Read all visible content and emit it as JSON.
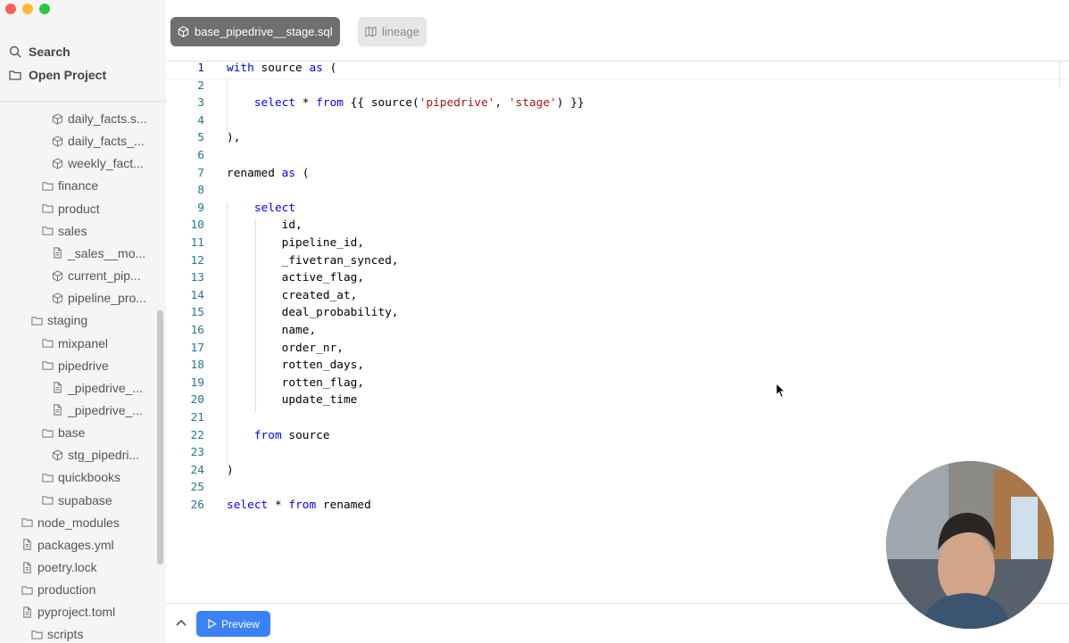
{
  "sidebar": {
    "search_label": "Search",
    "open_project_label": "Open Project",
    "tree": [
      {
        "label": "daily_facts.s...",
        "type": "model"
      },
      {
        "label": "daily_facts_...",
        "type": "model"
      },
      {
        "label": "weekly_fact...",
        "type": "model"
      },
      {
        "label": "finance",
        "type": "folder"
      },
      {
        "label": "product",
        "type": "folder"
      },
      {
        "label": "sales",
        "type": "folder"
      },
      {
        "label": "_sales__mo...",
        "type": "file"
      },
      {
        "label": "current_pip...",
        "type": "model"
      },
      {
        "label": "pipeline_pro...",
        "type": "model"
      },
      {
        "label": "staging",
        "type": "folder"
      },
      {
        "label": "mixpanel",
        "type": "folder"
      },
      {
        "label": "pipedrive",
        "type": "folder"
      },
      {
        "label": "_pipedrive_...",
        "type": "file"
      },
      {
        "label": "_pipedrive_...",
        "type": "file"
      },
      {
        "label": "base",
        "type": "folder"
      },
      {
        "label": "stg_pipedri...",
        "type": "model"
      },
      {
        "label": "quickbooks",
        "type": "folder"
      },
      {
        "label": "supabase",
        "type": "folder"
      },
      {
        "label": "node_modules",
        "type": "folder"
      },
      {
        "label": "packages.yml",
        "type": "file"
      },
      {
        "label": "poetry.lock",
        "type": "file"
      },
      {
        "label": "production",
        "type": "folder"
      },
      {
        "label": "pyproject.toml",
        "type": "file"
      },
      {
        "label": "scripts",
        "type": "folder"
      }
    ]
  },
  "tabs": {
    "active_label": "base_pipedrive__stage.sql",
    "lineage_label": "lineage"
  },
  "editor": {
    "lines": [
      {
        "n": "1",
        "tokens": [
          {
            "t": "with",
            "c": "kw"
          },
          {
            "t": " source "
          },
          {
            "t": "as",
            "c": "kw"
          },
          {
            "t": " ("
          }
        ]
      },
      {
        "n": "2",
        "tokens": []
      },
      {
        "n": "3",
        "tokens": [
          {
            "t": "    "
          },
          {
            "t": "select",
            "c": "kw"
          },
          {
            "t": " * "
          },
          {
            "t": "from",
            "c": "kw"
          },
          {
            "t": " {{ source("
          },
          {
            "t": "'pipedrive'",
            "c": "str"
          },
          {
            "t": ", "
          },
          {
            "t": "'stage'",
            "c": "str"
          },
          {
            "t": ") }}"
          }
        ]
      },
      {
        "n": "4",
        "tokens": []
      },
      {
        "n": "5",
        "tokens": [
          {
            "t": "),"
          }
        ]
      },
      {
        "n": "6",
        "tokens": []
      },
      {
        "n": "7",
        "tokens": [
          {
            "t": "renamed "
          },
          {
            "t": "as",
            "c": "kw"
          },
          {
            "t": " ("
          }
        ]
      },
      {
        "n": "8",
        "tokens": []
      },
      {
        "n": "9",
        "tokens": [
          {
            "t": "    "
          },
          {
            "t": "select",
            "c": "kw"
          }
        ]
      },
      {
        "n": "10",
        "tokens": [
          {
            "t": "        id,"
          }
        ]
      },
      {
        "n": "11",
        "tokens": [
          {
            "t": "        pipeline_id,"
          }
        ]
      },
      {
        "n": "12",
        "tokens": [
          {
            "t": "        _fivetran_synced,"
          }
        ]
      },
      {
        "n": "13",
        "tokens": [
          {
            "t": "        active_flag,"
          }
        ]
      },
      {
        "n": "14",
        "tokens": [
          {
            "t": "        created_at,"
          }
        ]
      },
      {
        "n": "15",
        "tokens": [
          {
            "t": "        deal_probability,"
          }
        ]
      },
      {
        "n": "16",
        "tokens": [
          {
            "t": "        name,"
          }
        ]
      },
      {
        "n": "17",
        "tokens": [
          {
            "t": "        order_nr,"
          }
        ]
      },
      {
        "n": "18",
        "tokens": [
          {
            "t": "        rotten_days,"
          }
        ]
      },
      {
        "n": "19",
        "tokens": [
          {
            "t": "        rotten_flag,"
          }
        ]
      },
      {
        "n": "20",
        "tokens": [
          {
            "t": "        update_time"
          }
        ]
      },
      {
        "n": "21",
        "tokens": []
      },
      {
        "n": "22",
        "tokens": [
          {
            "t": "    "
          },
          {
            "t": "from",
            "c": "kw"
          },
          {
            "t": " source"
          }
        ]
      },
      {
        "n": "23",
        "tokens": []
      },
      {
        "n": "24",
        "tokens": [
          {
            "t": ")"
          }
        ]
      },
      {
        "n": "25",
        "tokens": []
      },
      {
        "n": "26",
        "tokens": [
          {
            "t": "select",
            "c": "kw"
          },
          {
            "t": " * "
          },
          {
            "t": "from",
            "c": "kw"
          },
          {
            "t": " renamed"
          }
        ]
      }
    ]
  },
  "bottom": {
    "preview_label": "Preview"
  },
  "colors": {
    "keyword": "#0000ff",
    "string": "#a31515",
    "line_number": "#237893",
    "preview_button": "#3b82f6"
  }
}
